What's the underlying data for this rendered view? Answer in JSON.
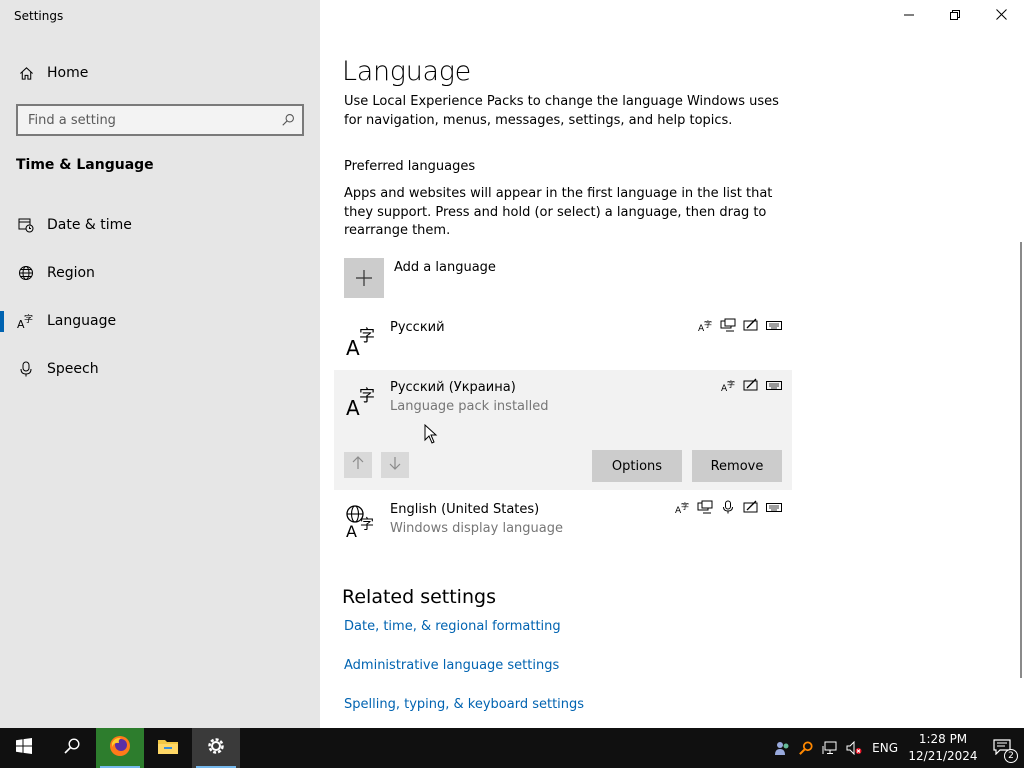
{
  "window": {
    "title": "Settings",
    "minimize_icon": "minimize-icon",
    "maximize_icon": "restore-icon",
    "close_icon": "close-icon"
  },
  "sidebar": {
    "home_label": "Home",
    "search_placeholder": "Find a setting",
    "section_title": "Time & Language",
    "items": [
      {
        "label": "Date & time",
        "icon": "calendar-clock-icon"
      },
      {
        "label": "Region",
        "icon": "globe-icon"
      },
      {
        "label": "Language",
        "icon": "language-icon",
        "active": true
      },
      {
        "label": "Speech",
        "icon": "microphone-icon"
      }
    ]
  },
  "main": {
    "title": "Language",
    "intro": "Use Local Experience Packs to change the language Windows uses for navigation, menus, messages, settings, and help topics.",
    "preferred_heading": "Preferred languages",
    "preferred_desc": "Apps and websites will appear in the first language in the list that they support. Press and hold (or select) a language, then drag to rearrange them.",
    "add_language_label": "Add a language",
    "languages": [
      {
        "name": "Русский",
        "subtitle": "",
        "features": [
          "handwriting-lang-icon",
          "display-icon",
          "handwriting-icon",
          "keyboard-icon"
        ]
      },
      {
        "name": "Русский (Украина)",
        "subtitle": "Language pack installed",
        "features": [
          "handwriting-lang-icon",
          "handwriting-icon",
          "keyboard-icon"
        ],
        "selected": true
      },
      {
        "name": "English (United States)",
        "subtitle": "Windows display language",
        "features": [
          "handwriting-lang-icon",
          "display-icon",
          "microphone-icon",
          "handwriting-icon",
          "keyboard-icon"
        ]
      }
    ],
    "options_label": "Options",
    "remove_label": "Remove",
    "related_title": "Related settings",
    "related_links": [
      "Date, time, & regional formatting",
      "Administrative language settings",
      "Spelling, typing, & keyboard settings"
    ]
  },
  "taskbar": {
    "apps": [
      "start-icon",
      "search-icon",
      "firefox-icon",
      "file-explorer-icon",
      "settings-icon"
    ],
    "ime": "ENG",
    "time": "1:28 PM",
    "date": "12/21/2024",
    "notifications": "2"
  },
  "colors": {
    "sidebar_bg": "#e6e6e6",
    "accent": "#0063b1",
    "taskbar_bg": "#101010"
  }
}
